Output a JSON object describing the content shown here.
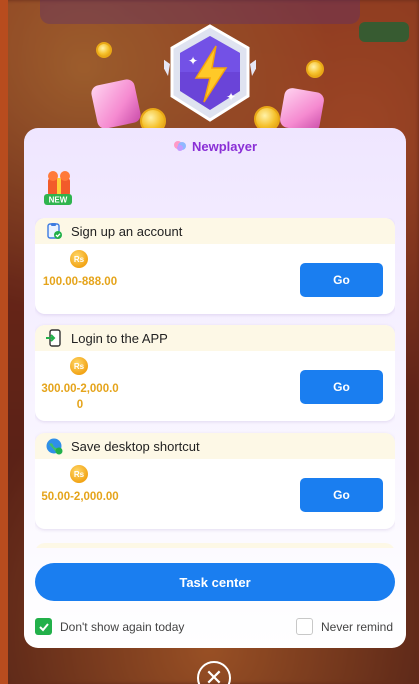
{
  "modal": {
    "title": "Newplayer",
    "new_badge": "NEW",
    "currency_symbol": "Rs",
    "tasks": [
      {
        "name": "Sign up an account",
        "amount": "100.00-888.00",
        "action": "Go",
        "icon": "clipboard-check-icon"
      },
      {
        "name": "Login to the APP",
        "amount": "300.00-2,000.00",
        "action": "Go",
        "icon": "phone-login-icon"
      },
      {
        "name": "Save desktop shortcut",
        "amount": "50.00-2,000.00",
        "action": "Go",
        "icon": "globe-shortcut-icon"
      }
    ],
    "task_center_label": "Task center",
    "dont_show_label": "Don't show again today",
    "dont_show_checked": true,
    "never_remind_label": "Never remind",
    "never_remind_checked": false
  },
  "colors": {
    "accent_blue": "#1a7ef0",
    "title_purple": "#8a2fd6",
    "reward_gold": "#e5a41b",
    "check_green": "#22b04a"
  }
}
